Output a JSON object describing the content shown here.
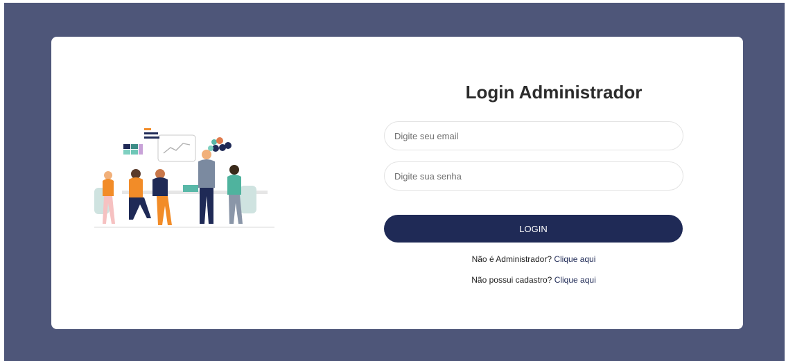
{
  "login": {
    "title": "Login Administrador",
    "email_placeholder": "Digite seu email",
    "password_placeholder": "Digite sua senha",
    "login_button": "LOGIN",
    "admin_question": "Não é Administrador?",
    "admin_link": "Clique aqui",
    "register_question": "Não possui cadastro?",
    "register_link": "Clique aqui"
  },
  "colors": {
    "background": "#4e5679",
    "card": "#ffffff",
    "primary": "#1f2a56"
  }
}
